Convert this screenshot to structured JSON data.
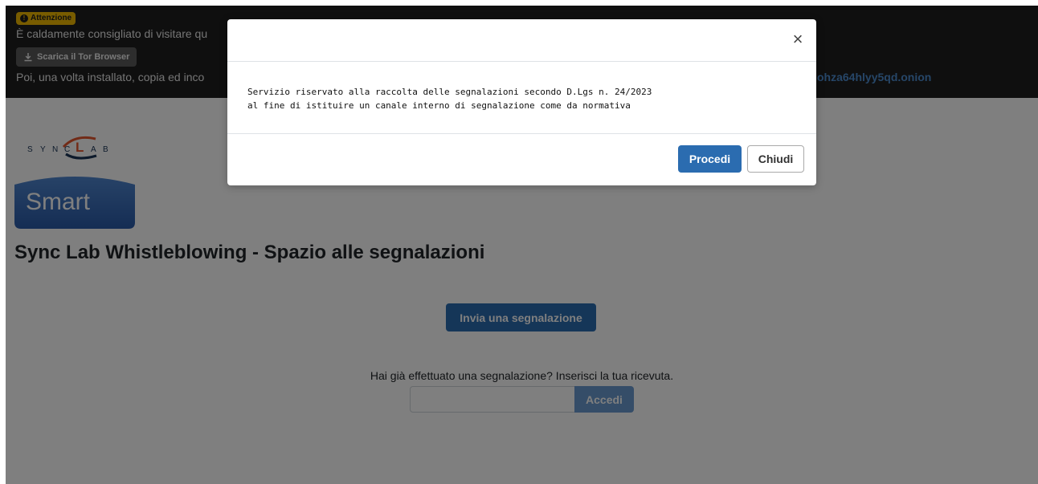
{
  "banner": {
    "badge_label": "Attenzione",
    "badge_icon": "exclamation-circle-icon",
    "line1": "È caldamente consigliato di visitare qu",
    "tor_button_label": "Scarica il Tor Browser",
    "tor_button_icon": "download-icon",
    "line2": "Poi, una volta installato, copia ed inco",
    "onion_link": "ohza64hlyy5qd.onion"
  },
  "logo": {
    "sync_letters": [
      "S",
      "Y",
      "N",
      "C",
      "L",
      "A",
      "B"
    ],
    "smart_label": "Smart"
  },
  "page": {
    "title": "Sync Lab Whistleblowing - Spazio alle segnalazioni",
    "send_button": "Invia una segnalazione",
    "receipt_label": "Hai già effettuato una segnalazione? Inserisci la tua ricevuta.",
    "receipt_value": "",
    "login_button": "Accedi"
  },
  "modal": {
    "close_glyph": "×",
    "body_line1": "Servizio riservato alla raccolta delle segnalazioni secondo D.Lgs n. 24/2023",
    "body_line2": "al fine di istituire un canale interno di segnalazione come da normativa",
    "proceed_button": "Procedi",
    "close_button": "Chiudi"
  },
  "colors": {
    "primary": "#2b6cb0",
    "warning_badge": "#f1b800",
    "banner_bg": "#1e1e1e",
    "link": "#4d8dd0",
    "logo_red": "#e4572e",
    "logo_navy": "#1a3556",
    "smart_blue": "#2f62b0"
  }
}
